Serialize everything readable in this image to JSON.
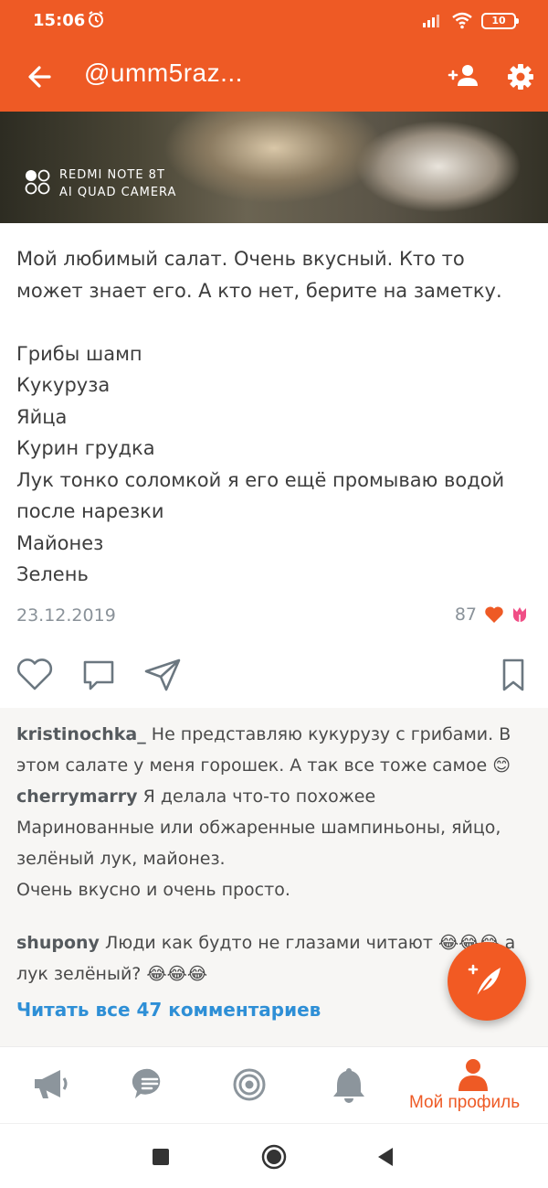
{
  "status_bar": {
    "time": "15:06",
    "battery": "10"
  },
  "app_bar": {
    "title": "@umm5raz...",
    "icons": [
      "back-arrow-icon",
      "add-friend-icon",
      "gear-icon"
    ]
  },
  "photo": {
    "watermark_line1": "REDMI NOTE 8T",
    "watermark_line2": "AI QUAD CAMERA"
  },
  "post": {
    "lines": [
      "Мой любимый салат. Очень вкусный. Кто то",
      "может знает его. А кто нет, берите на заметку.",
      "",
      "Грибы шамп",
      "Кукуруза",
      "Яйца",
      "Курин грудка",
      "Лук тонко соломкой я его ещё промываю водой",
      "после нарезки",
      "Майонез",
      "Зелень"
    ],
    "date": "23.12.2019",
    "likes_count": "87"
  },
  "actions": [
    "heart-icon",
    "comment-icon",
    "share-icon",
    "bookmark-icon"
  ],
  "comments": [
    {
      "author": "kristinochka_",
      "line1": " Не представляю кукурузу с грибами. В",
      "line2": "этом салате у меня горошек. А так все тоже самое 😊"
    },
    {
      "author": "cherrymarry",
      "line1": " Я делала что-то похожее",
      "line2": "Маринованные или обжаренные шампиньоны, яйцо,",
      "line3": "зелёный лук, майонез.",
      "line4": "Очень вкусно и очень просто."
    },
    {
      "author": "shupony",
      "line1": " Люди как будто не глазами читают 😂😂😂 а",
      "line2": "лук зелёный? 😂😂😂"
    }
  ],
  "read_all_label": "Читать все 47 комментариев",
  "bottom_nav": {
    "profile_label": "Мой профиль",
    "icons": [
      "megaphone-icon",
      "chat-icon",
      "target-icon",
      "bell-icon",
      "profile-icon"
    ]
  },
  "colors": {
    "brand": "#ee5a25",
    "link": "#2e8fd6",
    "muted": "#8a9299"
  }
}
